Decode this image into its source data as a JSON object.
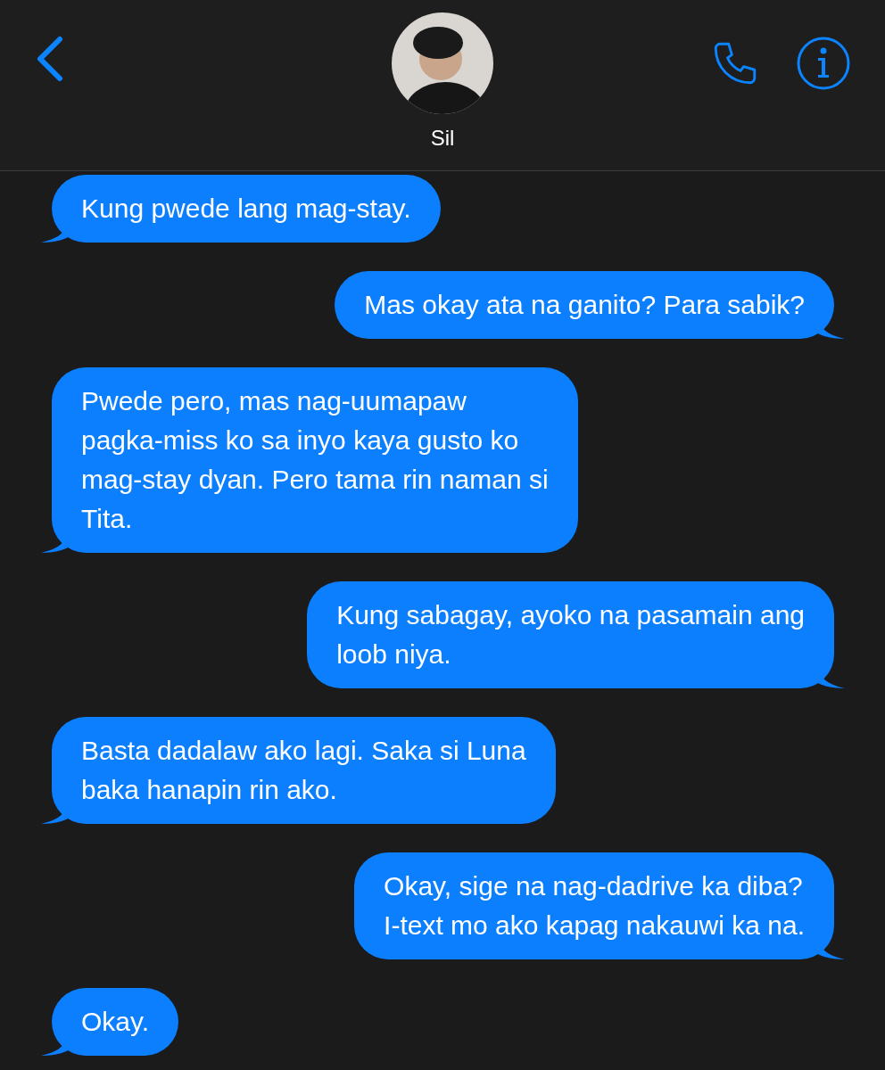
{
  "header": {
    "contact_name": "Sil"
  },
  "messages": [
    {
      "kind": "received",
      "lines": [
        "Kung pwede lang mag-stay."
      ]
    },
    {
      "kind": "sent",
      "lines": [
        "Mas okay ata na ganito? Para sabik?"
      ]
    },
    {
      "kind": "received",
      "lines": [
        "Pwede pero, mas nag-uumapaw",
        "pagka-miss ko sa inyo kaya gusto ko",
        "mag-stay dyan. Pero tama rin naman si",
        "Tita."
      ]
    },
    {
      "kind": "sent",
      "lines": [
        "Kung sabagay, ayoko na pasamain ang",
        "loob niya."
      ]
    },
    {
      "kind": "received",
      "lines": [
        "Basta dadalaw ako lagi. Saka si Luna",
        "baka hanapin rin ako."
      ]
    },
    {
      "kind": "sent",
      "lines": [
        "Okay, sige na nag-dadrive ka diba?",
        "I-text mo ako kapag nakauwi ka na."
      ]
    },
    {
      "kind": "received",
      "lines": [
        "Okay."
      ]
    }
  ]
}
